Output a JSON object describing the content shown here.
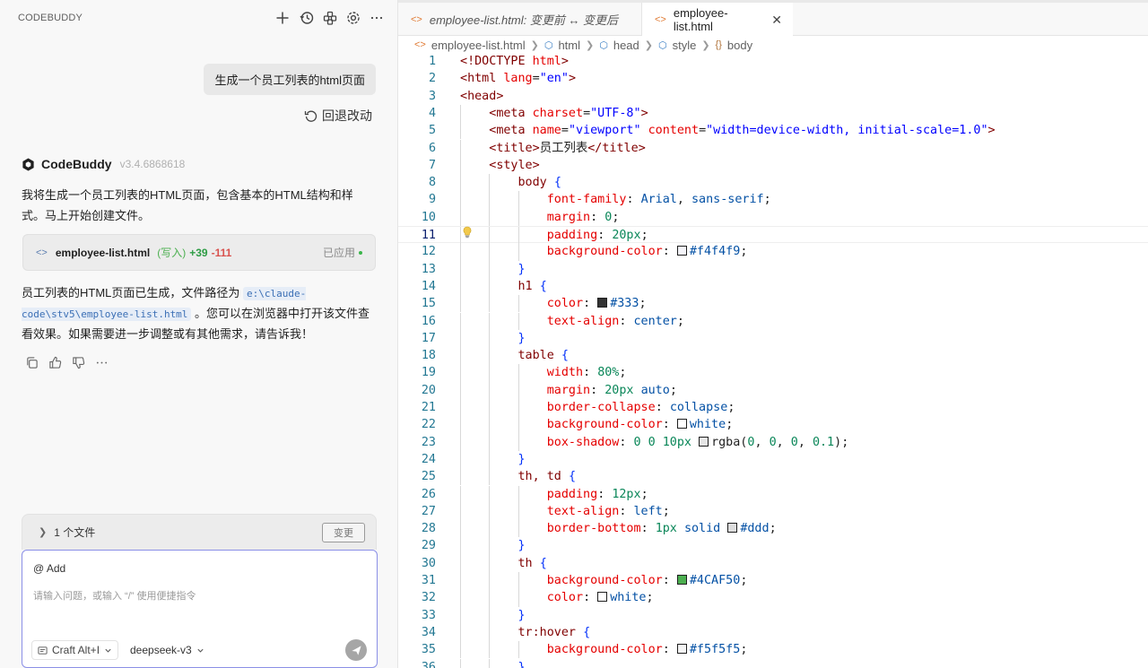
{
  "left_panel": {
    "title": "CODEBUDDY",
    "toolbar_icons": [
      "plus-icon",
      "history-icon",
      "extensions-icon",
      "settings-icon",
      "more-icon"
    ],
    "user_message": "生成一个员工列表的html页面",
    "revert_label": "回退改动",
    "bot": {
      "name": "CodeBuddy",
      "version": "v3.4.6868618",
      "text1": "我将生成一个员工列表的HTML页面，包含基本的HTML结构和样式。马上开始创建文件。",
      "file_card": {
        "filename": "employee-list.html",
        "mode": "(写入)",
        "additions": "+39",
        "deletions": "-111",
        "status": "已应用"
      },
      "text2_before": "员工列表的HTML页面已生成，文件路径为 ",
      "text2_path": "e:\\claude-code\\stv5\\employee-list.html",
      "text2_after": " 。您可以在浏览器中打开该文件查看效果。如果需要进一步调整或有其他需求，请告诉我！"
    },
    "files_bar": {
      "label": "1 个文件",
      "button": "变更"
    },
    "input": {
      "add_label": "@ Add",
      "placeholder": "请输入问题，或输入 “/” 使用便捷指令",
      "mode": "Craft Alt+I",
      "model": "deepseek-v3"
    }
  },
  "editor": {
    "tabs": [
      {
        "label": "employee-list.html: 变更前 ↔ 变更后",
        "active": false
      },
      {
        "label": "employee-list.html",
        "active": true
      }
    ],
    "breadcrumb": [
      "employee-list.html",
      "html",
      "head",
      "style",
      "body"
    ],
    "current_line": 11,
    "colors": {
      "f4f4f9": "#f4f4f9",
      "333": "#333333",
      "white": "#ffffff",
      "shadow": "rgba(0,0,0,0.1)",
      "ddd": "#dddddd",
      "green": "#4CAF50",
      "f5f5f5": "#f5f5f5"
    },
    "lines": [
      {
        "n": "1",
        "text": "<!DOCTYPE html>"
      },
      {
        "n": "2",
        "text": "<html lang=\"en\">"
      },
      {
        "n": "3",
        "text": "<head>"
      },
      {
        "n": "4",
        "text": "    <meta charset=\"UTF-8\">"
      },
      {
        "n": "5",
        "text": "    <meta name=\"viewport\" content=\"width=device-width, initial-scale=1.0\">"
      },
      {
        "n": "6",
        "text": "    <title>员工列表</title>"
      },
      {
        "n": "7",
        "text": "    <style>"
      },
      {
        "n": "8",
        "text": "        body {"
      },
      {
        "n": "9",
        "text": "            font-family: Arial, sans-serif;"
      },
      {
        "n": "10",
        "text": "            margin: 0;"
      },
      {
        "n": "11",
        "text": "            padding: 20px;"
      },
      {
        "n": "12",
        "text": "            background-color: #f4f4f9;"
      },
      {
        "n": "13",
        "text": "        }"
      },
      {
        "n": "14",
        "text": "        h1 {"
      },
      {
        "n": "15",
        "text": "            color: #333;"
      },
      {
        "n": "16",
        "text": "            text-align: center;"
      },
      {
        "n": "17",
        "text": "        }"
      },
      {
        "n": "18",
        "text": "        table {"
      },
      {
        "n": "19",
        "text": "            width: 80%;"
      },
      {
        "n": "20",
        "text": "            margin: 20px auto;"
      },
      {
        "n": "21",
        "text": "            border-collapse: collapse;"
      },
      {
        "n": "22",
        "text": "            background-color: white;"
      },
      {
        "n": "23",
        "text": "            box-shadow: 0 0 10px rgba(0, 0, 0, 0.1);"
      },
      {
        "n": "24",
        "text": "        }"
      },
      {
        "n": "25",
        "text": "        th, td {"
      },
      {
        "n": "26",
        "text": "            padding: 12px;"
      },
      {
        "n": "27",
        "text": "            text-align: left;"
      },
      {
        "n": "28",
        "text": "            border-bottom: 1px solid #ddd;"
      },
      {
        "n": "29",
        "text": "        }"
      },
      {
        "n": "30",
        "text": "        th {"
      },
      {
        "n": "31",
        "text": "            background-color: #4CAF50;"
      },
      {
        "n": "32",
        "text": "            color: white;"
      },
      {
        "n": "33",
        "text": "        }"
      },
      {
        "n": "34",
        "text": "        tr:hover {"
      },
      {
        "n": "35",
        "text": "            background-color: #f5f5f5;"
      },
      {
        "n": "36",
        "text": "        }"
      }
    ]
  }
}
